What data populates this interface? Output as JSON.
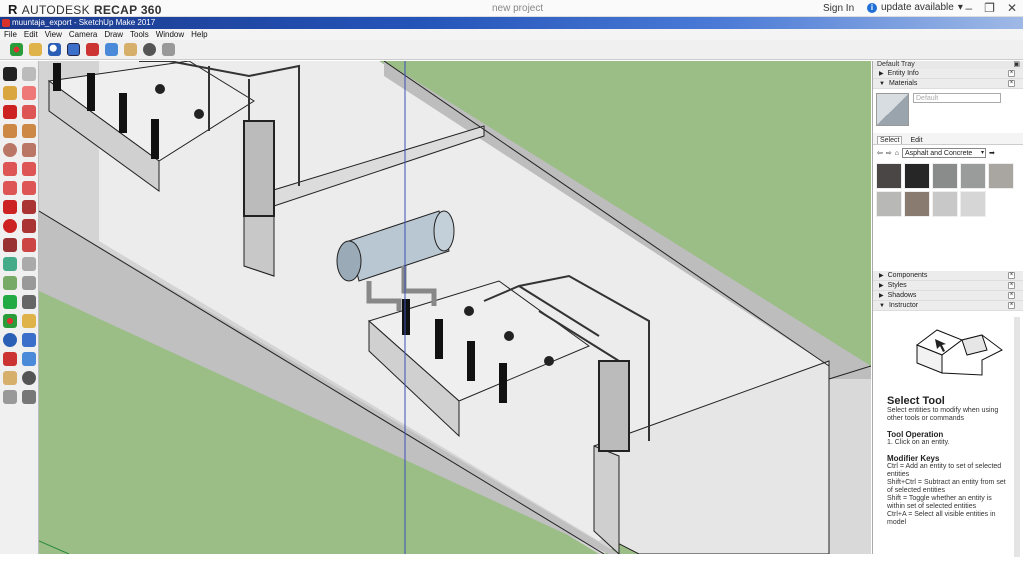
{
  "recap": {
    "brand": "AUTODESK",
    "product": "RECAP 360",
    "project": "new project",
    "sign_in": "Sign In",
    "update": "update available"
  },
  "sketchup": {
    "window_title": "muuntaja_export - SketchUp Make 2017"
  },
  "menu": [
    "File",
    "Edit",
    "View",
    "Camera",
    "Draw",
    "Tools",
    "Window",
    "Help"
  ],
  "tray": {
    "title": "Default Tray",
    "panels_top": [
      {
        "label": "Entity Info",
        "expanded": false
      },
      {
        "label": "Materials",
        "expanded": true
      }
    ],
    "materials": {
      "name_placeholder": "Default",
      "tabs": [
        "Select",
        "Edit"
      ],
      "collection": "Asphalt and Concrete",
      "swatches": [
        "#4a4645",
        "#262626",
        "#8a8c8c",
        "#9a9c9c",
        "#a9a6a2",
        "#b8b8b6",
        "#8a7b70",
        "#c8c8c8",
        "#d6d6d6"
      ]
    },
    "panels_bottom": [
      {
        "label": "Components",
        "expanded": false
      },
      {
        "label": "Styles",
        "expanded": false
      },
      {
        "label": "Shadows",
        "expanded": false
      },
      {
        "label": "Instructor",
        "expanded": true
      }
    ],
    "instructor": {
      "tool_title": "Select Tool",
      "tool_desc": "Select entities to modify when using other tools or commands",
      "operation_heading": "Tool Operation",
      "operation_steps": [
        "1. Click on an entity."
      ],
      "modifier_heading": "Modifier Keys",
      "modifier_keys": [
        "Ctrl = Add an entity to set of selected entities",
        "Shift+Ctrl = Subtract an entity from set of selected entities",
        "Shift = Toggle whether an entity is within set of selected entities",
        "Ctrl+A = Select all visible entities in model"
      ]
    }
  },
  "colors": {
    "ground": "#9bbd86",
    "wall_top": "#d9d9d9",
    "wall_side": "#c4c4c4",
    "floor": "#ececec",
    "title_blue": "#2453b8"
  }
}
